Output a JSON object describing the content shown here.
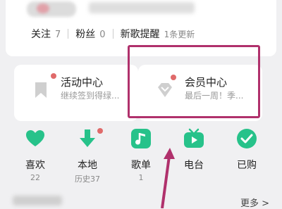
{
  "profile": {
    "follow_label": "关注",
    "follow_count": "7",
    "fans_label": "粉丝",
    "fans_count": "0",
    "new_song_label": "新歌提醒",
    "new_song_tag": "1条更新"
  },
  "cards": {
    "activity": {
      "title": "活动中心",
      "subtitle": "继续签到得绿..."
    },
    "member": {
      "title": "会员中心",
      "subtitle": "最后一周！季..."
    }
  },
  "quick": [
    {
      "label": "喜欢",
      "count": "22"
    },
    {
      "label": "本地",
      "count": "历史37"
    },
    {
      "label": "歌单",
      "count": "1"
    },
    {
      "label": "电台",
      "count": ""
    },
    {
      "label": "已购",
      "count": ""
    }
  ],
  "footer": {
    "more_label": "更多 >"
  },
  "colors": {
    "accent": "#27c28a",
    "highlight": "#b0316c",
    "badge": "#e06a6a"
  }
}
